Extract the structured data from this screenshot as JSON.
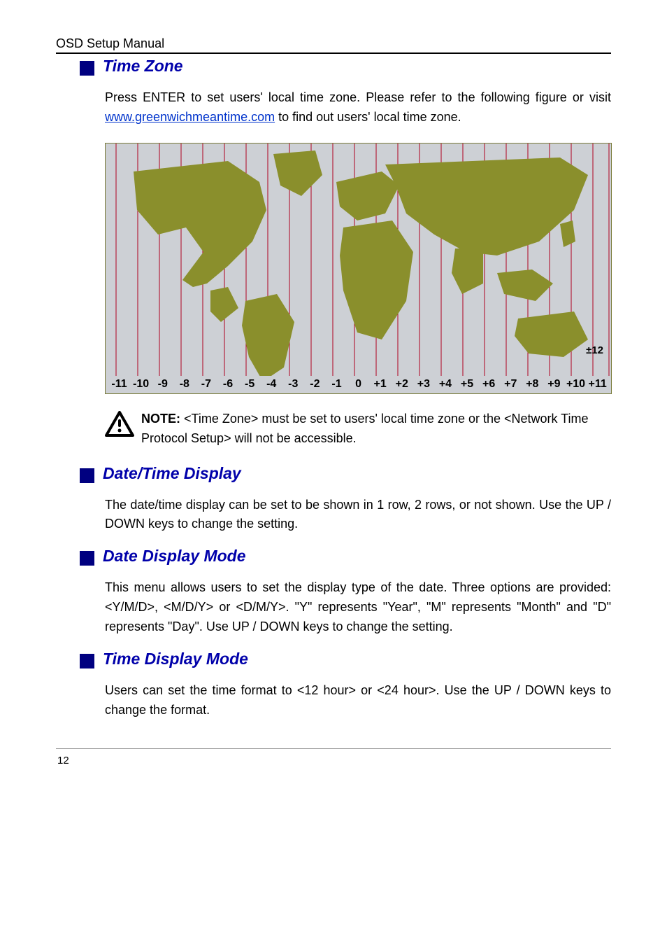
{
  "header": "OSD Setup Manual",
  "page_number": "12",
  "tz_labels": [
    "-11",
    "-10",
    "-9",
    "-8",
    "-7",
    "-6",
    "-5",
    "-4",
    "-3",
    "-2",
    "-1",
    "0",
    "+1",
    "+2",
    "+3",
    "+4",
    "+5",
    "+6",
    "+7",
    "+8",
    "+9",
    "+10",
    "+11"
  ],
  "tz_edge": "±12",
  "sections": {
    "timezone": {
      "title": "Time Zone",
      "p1a": "Press ENTER to set users' local time zone. Please refer to the following figure or visit ",
      "link": "www.greenwichmeantime.com",
      "p1b": " to find out users' local time zone."
    },
    "note": {
      "label": "NOTE:",
      "text": " <Time Zone> must be set to users' local time zone or the <Network Time Protocol Setup> will not be accessible."
    },
    "datetime": {
      "title": "Date/Time Display",
      "p": "The date/time display can be set to be shown in 1 row, 2 rows, or not shown. Use the UP / DOWN keys to change the setting."
    },
    "datemode": {
      "title": "Date Display Mode",
      "p": "This menu allows users to set the display type of the date. Three options are provided: <Y/M/D>, <M/D/Y> or <D/M/Y>. \"Y\" represents \"Year\", \"M\" represents \"Month\" and \"D\" represents \"Day\". Use UP / DOWN keys to change the setting."
    },
    "timemode": {
      "title": "Time Display Mode",
      "p": "Users can set the time format to <12 hour> or <24 hour>. Use the UP / DOWN keys to change the format."
    }
  }
}
